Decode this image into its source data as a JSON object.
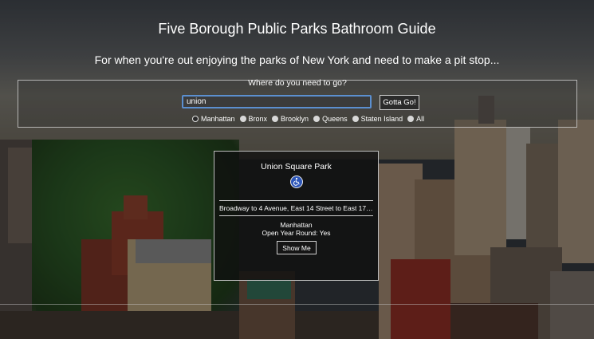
{
  "header": {
    "title": "Five Borough Public Parks Bathroom Guide",
    "subtitle": "For when you're out enjoying the parks of New York and need to make a pit stop..."
  },
  "search": {
    "prompt": "Where do you need to go?",
    "value": "union",
    "button_label": "Gotta Go!"
  },
  "boroughs": {
    "selected": "Manhattan",
    "options": [
      "Manhattan",
      "Bronx",
      "Brooklyn",
      "Queens",
      "Staten Island",
      "All"
    ]
  },
  "result": {
    "park_name": "Union Square Park",
    "accessibility_icon": "wheelchair-icon",
    "address": "Broadway to 4 Avenue, East 14 Street to East 17 ...",
    "borough": "Manhattan",
    "open_year_round": "Open Year Round: Yes",
    "button_label": "Show Me"
  },
  "colors": {
    "accessibility_blue": "#2d56b8",
    "input_focus_border": "#5b8fd0"
  }
}
